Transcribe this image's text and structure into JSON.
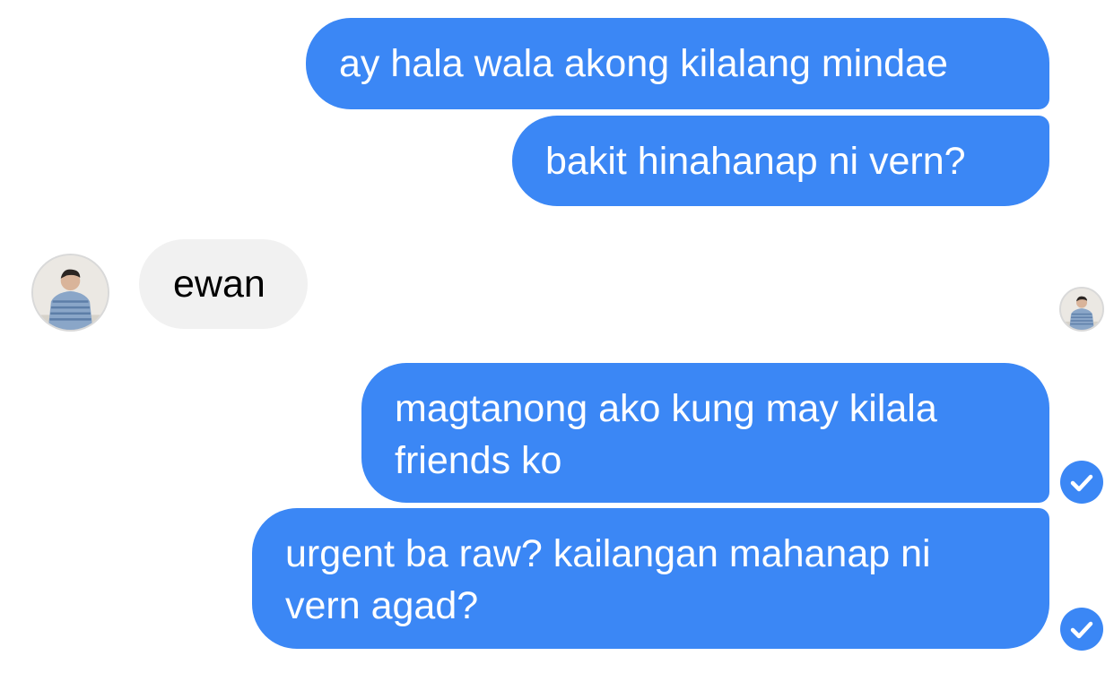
{
  "messages": [
    {
      "sender": "me",
      "lines": [
        "ay hala wala akong kilalang mindae"
      ]
    },
    {
      "sender": "me",
      "lines": [
        "bakit hinahanap ni vern?"
      ]
    },
    {
      "sender": "contact",
      "lines": [
        "ewan"
      ]
    },
    {
      "sender": "me",
      "lines": [
        "magtanong ako kung may kilala",
        "friends ko"
      ],
      "status_icon": "delivered-check-icon"
    },
    {
      "sender": "me",
      "lines": [
        "urgent ba raw? kailangan mahanap ni",
        "vern agad?"
      ],
      "status_icon": "delivered-check-icon"
    }
  ],
  "colors": {
    "sent_bubble": "#3b87f5",
    "sent_text": "#ffffff",
    "received_bubble": "#f1f1f1",
    "received_text": "#000000",
    "status_check": "#3b87f5"
  },
  "icons": {
    "contact_avatar": "contact-avatar-photo",
    "read_receipt": "read-receipt-avatar",
    "delivered": "delivered-check-icon"
  }
}
